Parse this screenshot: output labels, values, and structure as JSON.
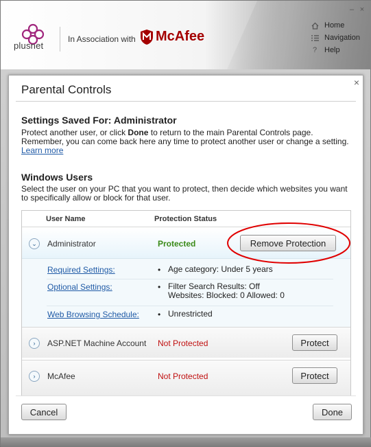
{
  "header": {
    "brand": "plusnet",
    "association_text": "In Association with",
    "partner_brand": "McAfee",
    "nav": [
      {
        "label": "Home",
        "icon": "home-icon"
      },
      {
        "label": "Navigation",
        "icon": "list-icon"
      },
      {
        "label": "Help",
        "icon": "question-icon"
      }
    ]
  },
  "window_controls": {
    "minimize": "–",
    "close": "×"
  },
  "dialog": {
    "title": "Parental Controls",
    "close_glyph": "×",
    "saved_heading": "Settings Saved For: Administrator",
    "saved_text_1": "Protect another user, or click ",
    "saved_text_bold": "Done",
    "saved_text_2": " to return to the main Parental Controls page. Remember, you can come back here any time to protect another user or change a setting. ",
    "learn_more": "Learn more",
    "users_heading": "Windows Users",
    "users_text": "Select the user on your PC that you want to protect, then decide which websites you want to specifically allow or block for that user.",
    "columns": {
      "user_name": "User Name",
      "protection_status": "Protection Status"
    },
    "users": [
      {
        "name": "Administrator",
        "status": "Protected",
        "action": "Remove Protection",
        "expanded_glyph": "⌄"
      },
      {
        "name": "ASP.NET Machine Account",
        "status": "Not Protected",
        "action": "Protect",
        "expanded_glyph": "›"
      },
      {
        "name": "McAfee",
        "status": "Not Protected",
        "action": "Protect",
        "expanded_glyph": "›"
      }
    ],
    "details": {
      "required_label": "Required Settings:",
      "required_value": "Age category: Under 5 years",
      "optional_label": "Optional Settings:",
      "optional_value_1": "Filter Search Results: Off",
      "optional_value_2": "Websites: Blocked: 0 Allowed: 0",
      "schedule_label": "Web Browsing Schedule:",
      "schedule_value": "Unrestricted"
    },
    "cancel_label": "Cancel",
    "done_label": "Done"
  },
  "colors": {
    "protected": "#3a8a18",
    "not_protected": "#c01010",
    "link": "#1f5aa6",
    "highlight_ellipse": "#e00000",
    "mcafee_red": "#a40000",
    "plusnet_purple": "#a0267d"
  }
}
